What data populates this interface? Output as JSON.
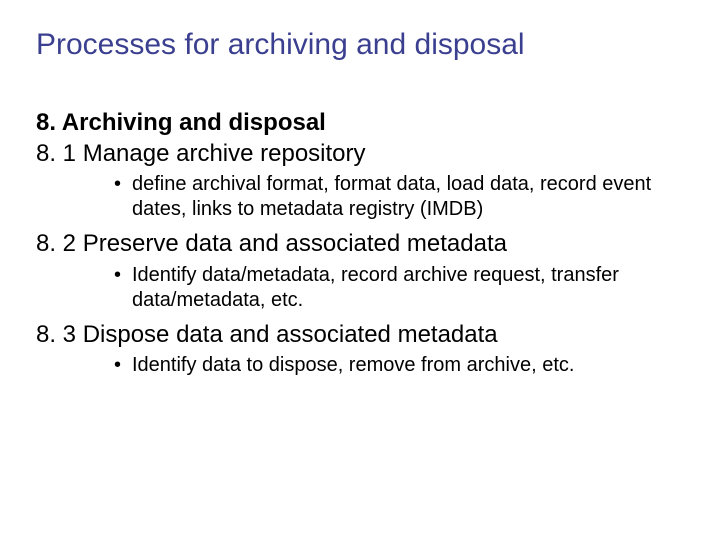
{
  "title": "Processes for archiving and disposal",
  "heading": "8. Archiving and disposal",
  "sections": [
    {
      "sub": "8. 1 Manage archive repository",
      "bullet": "define archival format, format data, load data, record event dates, links to metadata registry (IMDB)"
    },
    {
      "sub": "8. 2 Preserve data and associated metadata",
      "bullet": "Identify data/metadata, record archive request, transfer data/metadata, etc."
    },
    {
      "sub": "8. 3 Dispose data and associated metadata",
      "bullet": "Identify data to dispose, remove from archive, etc."
    }
  ]
}
